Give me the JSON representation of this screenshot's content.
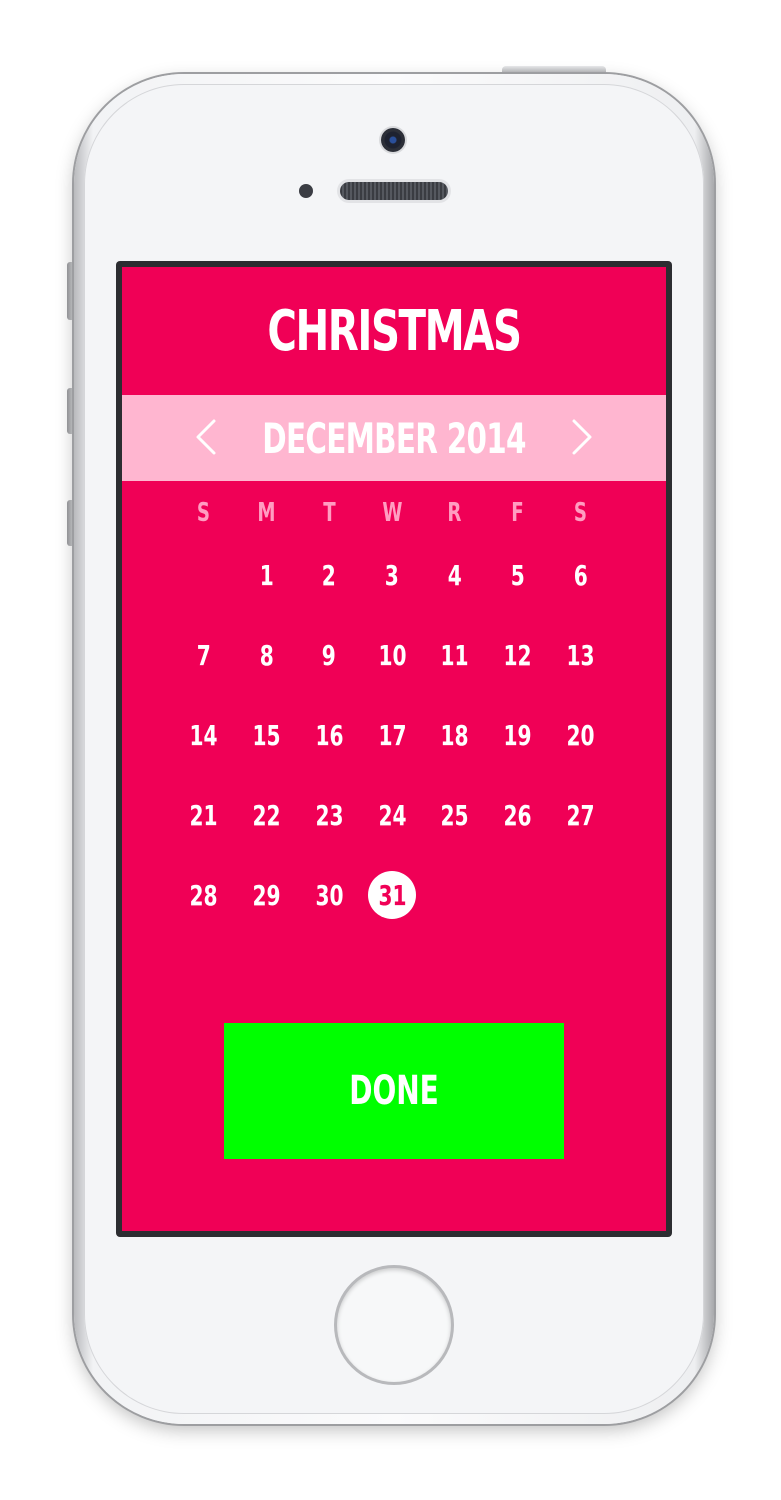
{
  "app": {
    "title": "CHRISTMAS",
    "accent_color": "#f00056",
    "month_bar_color": "#ffb6d0",
    "done_color": "#00ff00"
  },
  "calendar": {
    "month_label": "DECEMBER 2014",
    "prev_icon": "chevron-left-icon",
    "next_icon": "chevron-right-icon",
    "weekdays": [
      "S",
      "M",
      "T",
      "W",
      "R",
      "F",
      "S"
    ],
    "leading_blank_days": 1,
    "days": [
      "1",
      "2",
      "3",
      "4",
      "5",
      "6",
      "7",
      "8",
      "9",
      "10",
      "11",
      "12",
      "13",
      "14",
      "15",
      "16",
      "17",
      "18",
      "19",
      "20",
      "21",
      "22",
      "23",
      "24",
      "25",
      "26",
      "27",
      "28",
      "29",
      "30",
      "31"
    ],
    "selected_day": "31"
  },
  "actions": {
    "done_label": "DONE"
  }
}
